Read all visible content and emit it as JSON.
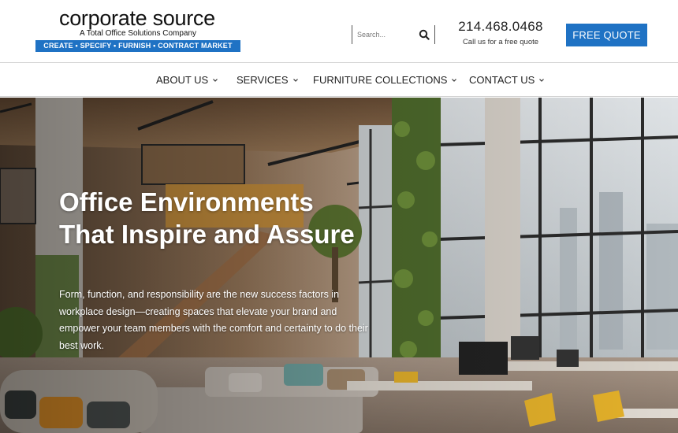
{
  "logo": {
    "name": "corporate source",
    "tagline": "A Total Office Solutions Company",
    "bar": "CREATE • SPECIFY • FURNISH • CONTRACT MARKET",
    "bar_color": "#1f72c4"
  },
  "search": {
    "placeholder": "Search...",
    "value": "",
    "icon": "search-icon"
  },
  "phone": {
    "number": "214.468.0468",
    "subtitle": "Call us for a free quote"
  },
  "cta": {
    "label": "FREE QUOTE",
    "color": "#1f72c4"
  },
  "nav": {
    "items": [
      {
        "label": "ABOUT US",
        "icon": "chevron-down-icon"
      },
      {
        "label": "SERVICES",
        "icon": "chevron-down-icon"
      },
      {
        "label": "FURNITURE COLLECTIONS",
        "icon": "chevron-down-icon"
      },
      {
        "label": "CONTACT US",
        "icon": "chevron-down-icon"
      }
    ]
  },
  "hero": {
    "title": "Office Environments That Inspire and Assure",
    "body": "Form, function, and responsibility are the new success factors in workplace design—creating spaces that elevate your brand and empower your team members with the comfort and certainty to do their best work."
  }
}
